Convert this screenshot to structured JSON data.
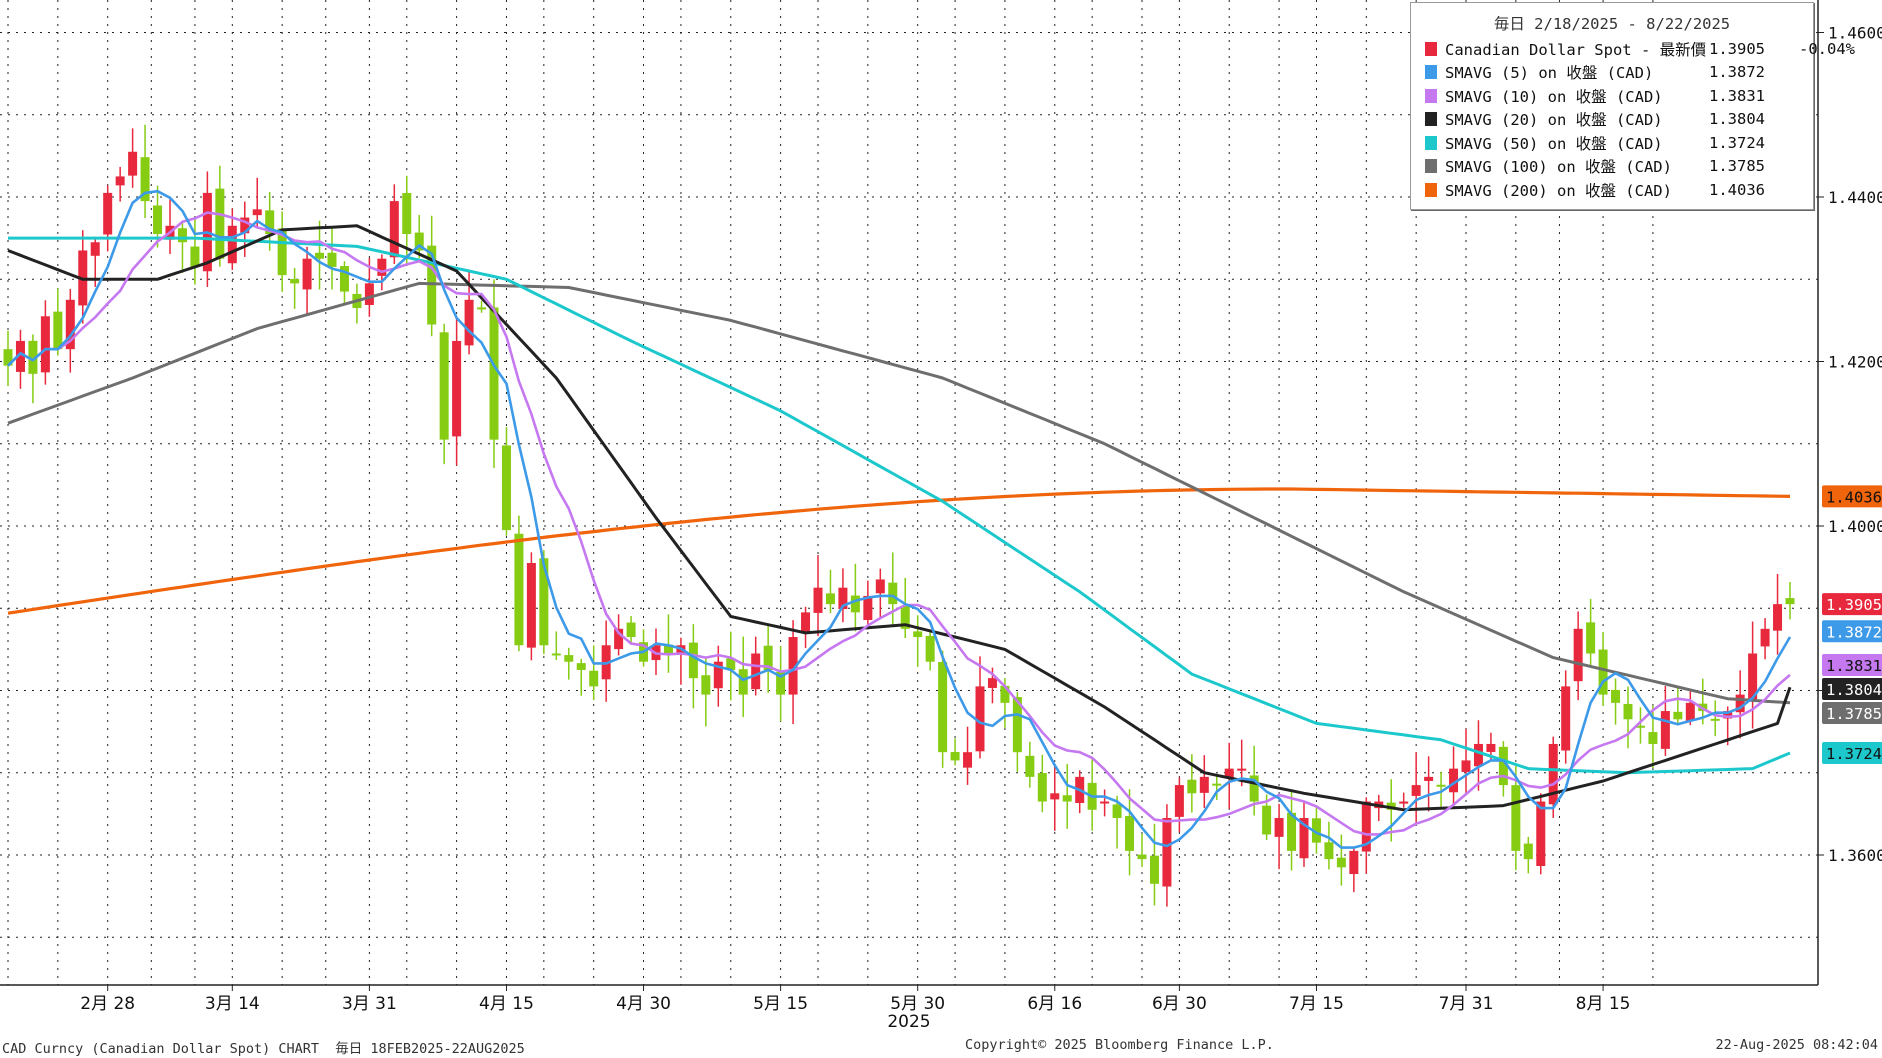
{
  "chart_data": {
    "type": "candlestick",
    "title": "CAD Curncy (Canadian Dollar Spot) CHART",
    "frequency": "毎日",
    "date_range": "18FEB2025-22AUG2025",
    "legend_period": "毎日 2/18/2025 - 8/22/2025",
    "year_label": "2025",
    "x_ticks": [
      {
        "label": "2月 28",
        "index": 8
      },
      {
        "label": "3月 14",
        "index": 18
      },
      {
        "label": "3月 31",
        "index": 29
      },
      {
        "label": "4月 15",
        "index": 40
      },
      {
        "label": "4月 30",
        "index": 51
      },
      {
        "label": "5月 15",
        "index": 62
      },
      {
        "label": "5月 30",
        "index": 73
      },
      {
        "label": "6月 16",
        "index": 84
      },
      {
        "label": "6月 30",
        "index": 94
      },
      {
        "label": "7月 15",
        "index": 105
      },
      {
        "label": "7月 31",
        "index": 117
      },
      {
        "label": "8月 15",
        "index": 128
      }
    ],
    "y_ticks": [
      "1.3600",
      "1.3800",
      "1.4000",
      "1.4200",
      "1.4400",
      "1.4600"
    ],
    "ylim": [
      1.347,
      1.4625
    ],
    "grid": true,
    "legend_position": "top-right",
    "candles_pattern": {
      "up_color": "#e8283c",
      "down_color": "#86cc12",
      "series": "close",
      "close": [
        1.4195,
        1.4225,
        1.4185,
        1.4255,
        1.4215,
        1.4275,
        1.4335,
        1.4345,
        1.4405,
        1.4425,
        1.4455,
        1.4395,
        1.4355,
        1.4365,
        1.4345,
        1.4315,
        1.4405,
        1.4325,
        1.4365,
        1.4375,
        1.4385,
        1.4355,
        1.4305,
        1.4295,
        1.4325,
        1.4325,
        1.4315,
        1.4285,
        1.4265,
        1.4295,
        1.4325,
        1.4395,
        1.4355,
        1.4335,
        1.4245,
        1.4105,
        1.4225,
        1.4275,
        1.4265,
        1.4105,
        1.3995,
        1.3855,
        1.3955,
        1.3855,
        1.3845,
        1.3835,
        1.3825,
        1.3805,
        1.3855,
        1.3875,
        1.3865,
        1.3835,
        1.3855,
        1.3845,
        1.3855,
        1.3815,
        1.3795,
        1.3835,
        1.3825,
        1.3795,
        1.3845,
        1.3825,
        1.3795,
        1.3865,
        1.3895,
        1.3925,
        1.3905,
        1.3925,
        1.3895,
        1.3915,
        1.3935,
        1.3905,
        1.3875,
        1.3865,
        1.3835,
        1.3725,
        1.3715,
        1.3725,
        1.3805,
        1.3815,
        1.3785,
        1.3725,
        1.3695,
        1.3665,
        1.3675,
        1.3665,
        1.3695,
        1.3655,
        1.3665,
        1.3645,
        1.3605,
        1.3595,
        1.3565,
        1.3645,
        1.3685,
        1.3675,
        1.3695,
        1.3685,
        1.3705,
        1.3705,
        1.3665,
        1.3625,
        1.3645,
        1.3605,
        1.3645,
        1.3615,
        1.3595,
        1.3585,
        1.3605,
        1.3665,
        1.3665,
        1.3655,
        1.3665,
        1.3685,
        1.3695,
        1.3685,
        1.3705,
        1.3715,
        1.3735,
        1.3735,
        1.3685,
        1.3605,
        1.3595,
        1.3665,
        1.3735,
        1.3805,
        1.3875,
        1.3845,
        1.3795,
        1.3785,
        1.3765,
        1.3755,
        1.3735,
        1.3775,
        1.3765,
        1.3785,
        1.3775,
        1.3765,
        1.3775,
        1.3795,
        1.3845,
        1.3875,
        1.3905,
        1.3905
      ]
    },
    "series": [
      {
        "name": "Canadian Dollar Spot - 最新價",
        "value": "1.3905",
        "change": "-0.04%",
        "color": "#e8283c"
      },
      {
        "name": "SMAVG (5) on 收盤 (CAD)",
        "value": "1.3872",
        "color": "#3c9ae8"
      },
      {
        "name": "SMAVG (10) on 收盤 (CAD)",
        "value": "1.3831",
        "color": "#c678f0"
      },
      {
        "name": "SMAVG (20) on 收盤 (CAD)",
        "value": "1.3804",
        "color": "#222222"
      },
      {
        "name": "SMAVG (50) on 收盤 (CAD)",
        "value": "1.3724",
        "color": "#1cc8cc"
      },
      {
        "name": "SMAVG (100) on 收盤 (CAD)",
        "value": "1.3785",
        "color": "#6e6e6e"
      },
      {
        "name": "SMAVG (200) on 收盤 (CAD)",
        "value": "1.4036",
        "color": "#f0640c"
      }
    ],
    "price_tags": [
      {
        "value": 1.4036,
        "label": "1.4036",
        "bg": "#f0640c",
        "fg": "#111111"
      },
      {
        "value": 1.3905,
        "label": "1.3905",
        "bg": "#e8283c",
        "fg": "#ffffff"
      },
      {
        "value": 1.3872,
        "label": "1.3872",
        "bg": "#3c9ae8",
        "fg": "#ffffff"
      },
      {
        "value": 1.3831,
        "label": "1.3831",
        "bg": "#c678f0",
        "fg": "#111111"
      },
      {
        "value": 1.3804,
        "label": "1.3804",
        "bg": "#222222",
        "fg": "#ffffff"
      },
      {
        "value": 1.3785,
        "label": "1.3785",
        "bg": "#6e6e6e",
        "fg": "#ffffff"
      },
      {
        "value": 1.3724,
        "label": "1.3724",
        "bg": "#1cc8cc",
        "fg": "#111111"
      }
    ]
  },
  "footer": {
    "left": "CAD Curncy (Canadian Dollar Spot) CHART  毎日 18FEB2025-22AUG2025",
    "center": "Copyright© 2025 Bloomberg Finance L.P.",
    "right": "22-Aug-2025 08:42:04"
  }
}
